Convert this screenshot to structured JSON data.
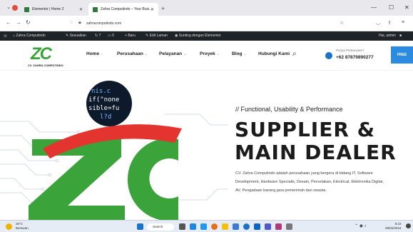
{
  "browser": {
    "tabs": [
      {
        "label": "Elementor | Home 2"
      },
      {
        "label": "Zahra Computindo – Your Busi..."
      }
    ],
    "url": "zahracomputindo.com"
  },
  "admin_bar": {
    "items": [
      "Zahra Computindo",
      "Sesuaikan",
      "7",
      "0",
      "Baru",
      "Edit Laman",
      "Sunting dengan Elementor"
    ],
    "user": "Hai, admin"
  },
  "header": {
    "logo_text": "ZC",
    "logo_sub": "CV. ZAHRA COMPUTINDO",
    "menu": [
      "Home",
      "Perusahaan",
      "Pelayanan",
      "Proyek",
      "Blog",
      "Hubungi Kami"
    ],
    "ask_label": "Punya Pertanyaan?",
    "phone": "+62 87879890277",
    "cta": "FREE"
  },
  "hero": {
    "code_lines": [
      "nis.c",
      "if(\"none",
      "sible=fu",
      "l?d"
    ],
    "tagline": "// Functional, Usability & Performance",
    "title_line1": "SUPPLIER &",
    "title_line2": "MAIN DEALER",
    "description": "CV. Zahra Computindo adalah perusahaan yang bergera di bidang IT, Software Development, Hardware Specialis, Desain, Percetakan, Electrical, Elektronika Digital, AV, Pengadaan barang jasa pemerintah dan swasta.",
    "accent_green": "#3aa43a",
    "accent_red": "#e3342f"
  },
  "taskbar": {
    "weather_temp": "28°C",
    "weather_text": "Berawan",
    "search": "Search",
    "time": "8:22",
    "date": "09/02/2024"
  }
}
